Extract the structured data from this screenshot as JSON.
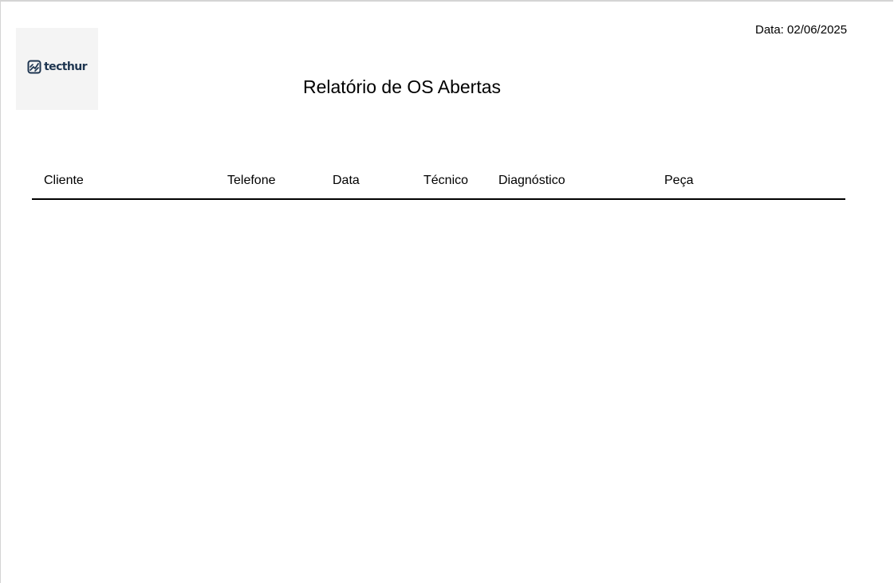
{
  "header": {
    "logo": {
      "icon": "techthur-logo-mark",
      "text": "tecthur",
      "brand_color": "#1e3550"
    },
    "date_label": "Data: 02/06/2025",
    "title": "Relatório de OS Abertas"
  },
  "table": {
    "columns": [
      "Cliente",
      "Telefone",
      "Data",
      "Técnico",
      "Diagnóstico",
      "Peça"
    ],
    "rows": []
  }
}
